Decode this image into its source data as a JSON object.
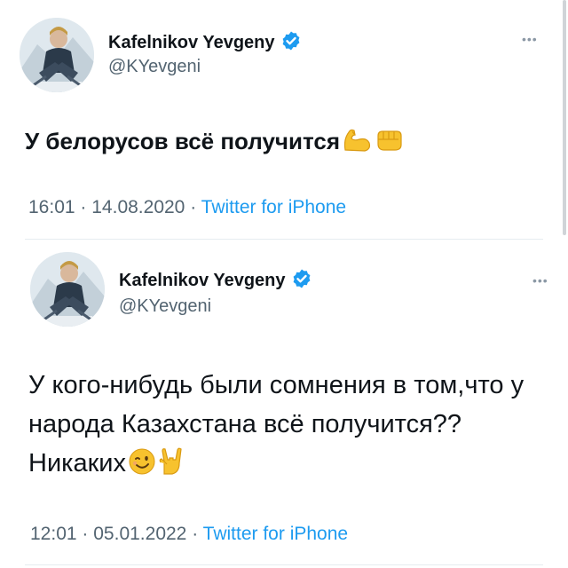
{
  "tweets": [
    {
      "name": "Kafelnikov Yevgeny",
      "handle": "@KYevgeni",
      "text": "У белорусов всё получится",
      "emojis": [
        "flexed-biceps",
        "oncoming-fist"
      ],
      "time": "16:01",
      "date": "14.08.2020",
      "source": "Twitter for iPhone",
      "verified": true
    },
    {
      "name": "Kafelnikov Yevgeny",
      "handle": "@KYevgeni",
      "text": "У кого-нибудь были сомнения в том,что у народа Казахстана всё получится?? Никаких",
      "emojis": [
        "winking-face",
        "sign-of-the-horns"
      ],
      "time": "12:01",
      "date": "05.01.2022",
      "source": "Twitter for iPhone",
      "verified": true
    }
  ],
  "separator": "·",
  "more_glyph": "•••",
  "colors": {
    "verified": "#1d9bf0",
    "link": "#1d9bf0",
    "secondary_text": "#536471",
    "divider": "#e6ecf0"
  }
}
